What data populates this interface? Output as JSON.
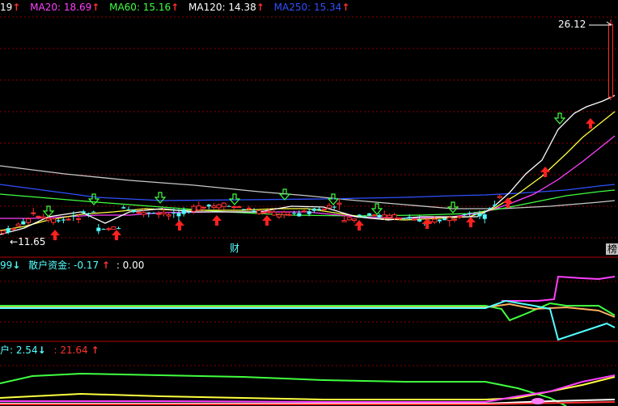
{
  "main_indicator": {
    "items": [
      {
        "text": "19",
        "color": "#ffffff",
        "arrow": "↑",
        "arrow_color": "#ff3030"
      },
      {
        "text": "MA20: 18.69",
        "color": "#ff40ff",
        "arrow": "↑",
        "arrow_color": "#ff3030"
      },
      {
        "text": "MA60: 15.16",
        "color": "#40ff40",
        "arrow": "↑",
        "arrow_color": "#ff3030"
      },
      {
        "text": "MA120: 14.38",
        "color": "#ffffff",
        "arrow": "↑",
        "arrow_color": "#ff3030"
      },
      {
        "text": "MA250: 15.34",
        "color": "#3050ff",
        "arrow": "↑",
        "arrow_color": "#ff3030"
      }
    ],
    "high_price": "26.12",
    "low_price": "11.65",
    "price_range": [
      11,
      27
    ],
    "badge_cai": "财",
    "badge_bang": "榜"
  },
  "panel2": {
    "prefix": "99",
    "prefix_arrow": "↓",
    "name": "散户资金",
    "value": ": -0.17",
    "value_arrow": "↑",
    "value2": ": 0.00"
  },
  "panel3": {
    "prefix": "户: 2.54",
    "prefix_arrow": "↓",
    "value": ": 21.64",
    "value_arrow": "↑"
  },
  "colors": {
    "grid": "#8b0000",
    "up": "#ff3030",
    "down": "#54ffff",
    "ma5": "#ffffff",
    "ma10": "#ffff40",
    "ma20": "#ff40ff",
    "ma60": "#40ff40",
    "ma120": "#c8c8c8",
    "ma250": "#3050ff",
    "signal_buy": "#ff2020",
    "signal_sell": "#40ff40"
  }
}
